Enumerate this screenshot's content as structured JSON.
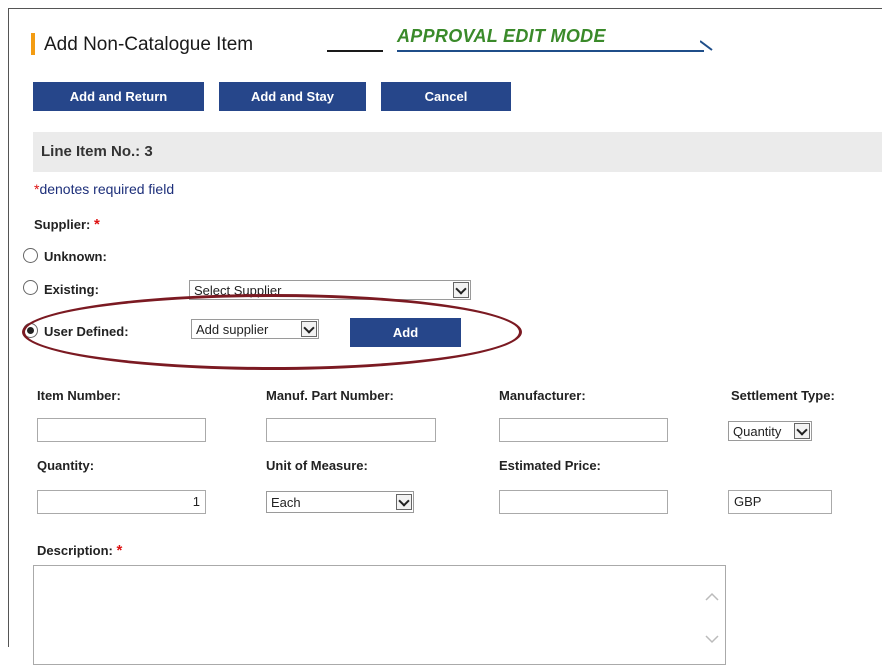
{
  "header": {
    "title": "Add Non-Catalogue Item",
    "mode_label": "APPROVAL EDIT MODE",
    "accent_color": "#f39c12",
    "mode_color": "#3a8a2a"
  },
  "toolbar": {
    "add_return_label": "Add and Return",
    "add_stay_label": "Add and Stay",
    "cancel_label": "Cancel"
  },
  "line_item": {
    "label": "Line Item No.: 3"
  },
  "required_note": {
    "star": "*",
    "text": "denotes required field"
  },
  "supplier": {
    "label": "Supplier:",
    "required_star": "*",
    "options": [
      {
        "label": "Unknown:",
        "selected": false
      },
      {
        "label": "Existing:",
        "selected": false,
        "select_value": "Select Supplier"
      },
      {
        "label": "User Defined:",
        "selected": true,
        "select_value": "Add supplier",
        "button_label": "Add"
      }
    ]
  },
  "fields": {
    "item_number": {
      "label": "Item Number:",
      "value": ""
    },
    "manuf_part_number": {
      "label": "Manuf. Part Number:",
      "value": ""
    },
    "manufacturer": {
      "label": "Manufacturer:",
      "value": ""
    },
    "settlement_type": {
      "label": "Settlement Type:",
      "value": "Quantity"
    },
    "quantity": {
      "label": "Quantity:",
      "value": "1"
    },
    "unit_of_measure": {
      "label": "Unit of Measure:",
      "value": "Each"
    },
    "estimated_price": {
      "label": "Estimated Price:",
      "value": ""
    },
    "currency": {
      "value": "GBP"
    },
    "description": {
      "label": "Description:",
      "required_star": "*",
      "value": ""
    }
  }
}
